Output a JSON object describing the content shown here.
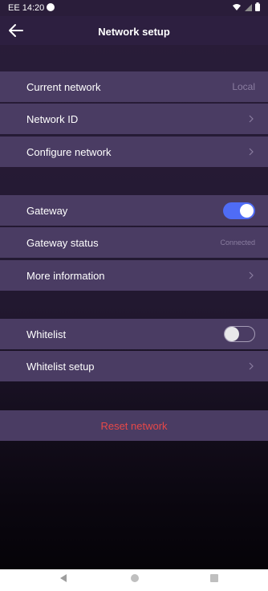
{
  "status_bar": {
    "time": "EE 14:20",
    "icons": [
      "notification-dot-icon",
      "wifi-icon",
      "signal-icon",
      "battery-icon"
    ]
  },
  "header": {
    "title": "Network setup",
    "back_icon": "arrow-left-icon"
  },
  "network_section": {
    "current_network_label": "Current network",
    "current_network_value": "Local",
    "network_id_label": "Network ID",
    "configure_network_label": "Configure network"
  },
  "gateway_section": {
    "gateway_label": "Gateway",
    "gateway_enabled": true,
    "gateway_status_label": "Gateway status",
    "gateway_status_value": "Connected",
    "more_information_label": "More information"
  },
  "whitelist_section": {
    "whitelist_label": "Whitelist",
    "whitelist_enabled": false,
    "whitelist_setup_label": "Whitelist setup"
  },
  "actions": {
    "reset_network_label": "Reset network"
  },
  "colors": {
    "row_background": "#4a3c63",
    "toggle_on": "#4f6cf6",
    "reset_text": "#e64848",
    "value_text": "#8a7da0"
  }
}
